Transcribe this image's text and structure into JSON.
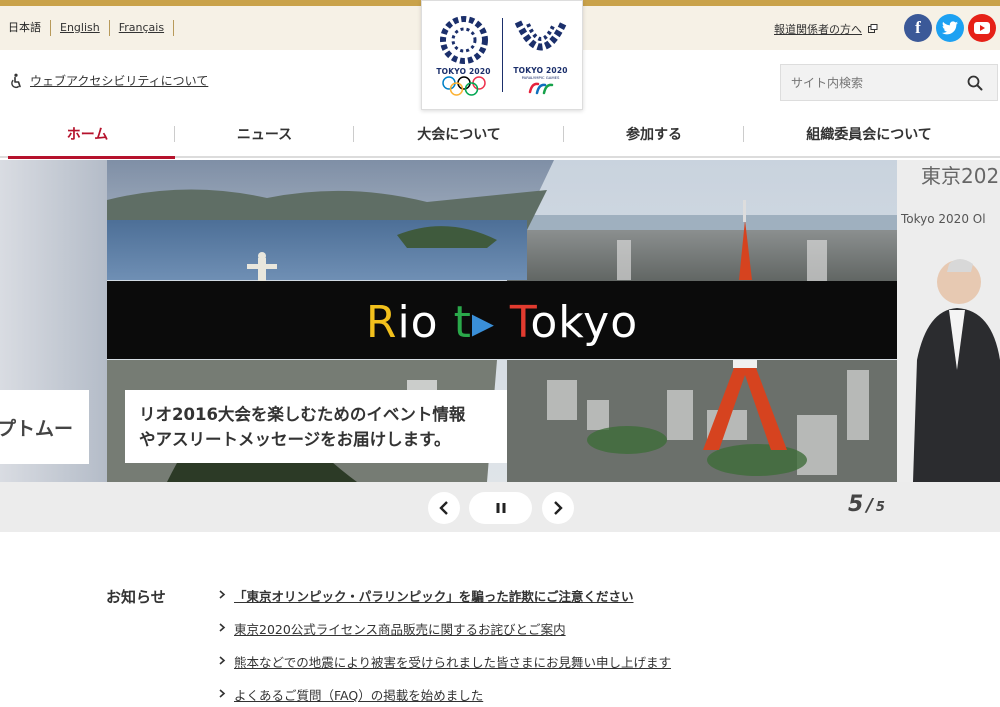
{
  "header": {
    "languages": [
      "日本語",
      "English",
      "Français"
    ],
    "press_link": "報道関係者の方へ",
    "social": {
      "facebook": "f",
      "twitter": "t",
      "youtube": "▶"
    },
    "accessibility_link": "ウェブアクセシビリティについて",
    "search_placeholder": "サイト内検索",
    "logo": {
      "left_text": "TOKYO 2020",
      "right_text": "TOKYO 2020",
      "right_sub": "PARALYMPIC GAMES"
    }
  },
  "nav": {
    "items": [
      "ホーム",
      "ニュース",
      "大会について",
      "参加する",
      "組織委員会について"
    ],
    "active_index": 0
  },
  "hero": {
    "banner_text": "Rio to Tokyo",
    "caption_line1": "リオ2016大会を楽しむためのイベント情報",
    "caption_line2": "やアスリートメッセージをお届けします。",
    "prev_caption_fragment": "プトムー",
    "next_title1": "東京202",
    "next_title2": "Tokyo 2020 Ol",
    "current_slide": "5",
    "total_slides": "5"
  },
  "news": {
    "label": "お知らせ",
    "items": [
      "「東京オリンピック・パラリンピック」を騙った詐欺にご注意ください",
      "東京2020公式ライセンス商品販売に関するお詫びとご案内",
      "熊本などでの地震により被害を受けられました皆さまにお見舞い申し上げます",
      "よくあるご質問（FAQ）の掲載を始めました"
    ]
  },
  "colors": {
    "accent_red": "#b5122c",
    "gold": "#c9a24a",
    "navy": "#1b2f6b"
  }
}
